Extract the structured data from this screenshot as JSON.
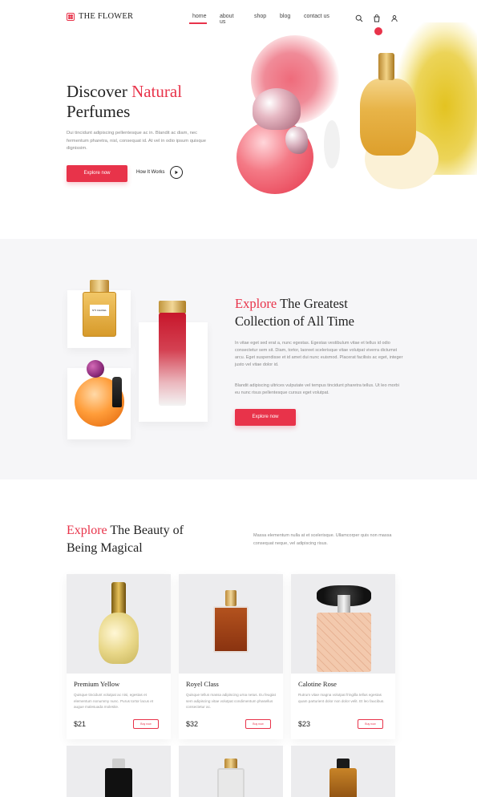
{
  "brand": {
    "name": "THE FLOWER",
    "accent": "#e8334a"
  },
  "nav": {
    "items": [
      "home",
      "about us",
      "shop",
      "blog",
      "contact us"
    ],
    "active": "home"
  },
  "header_icons": [
    "search-icon",
    "cart-icon",
    "user-icon"
  ],
  "hero": {
    "title_part1": "Discover",
    "title_accent": "Natural",
    "title_part2": "Perfumes",
    "text": "Dui tincidunt adipiscing pellentesque ac in. Blandit ac diam, nec fermentum pharetra, nisl, consequat id. At vel in odio ipsum quisque dignissim.",
    "primary_button": "Explore now",
    "secondary_link": "How It Works"
  },
  "collection": {
    "title_accent": "Explore",
    "title_rest_line1": "The Greatest",
    "title_line2": "Collection of All Time",
    "paragraph1": "In vitae eget sed erat a, nunc egestas. Egestas vestibulum vitae et tellus id odio consectetur sem sit. Diam, tortor, laoreet scelerisque vitae volutpat viverra dictumst arcu. Eget suspendisse et id amet dui nunc euismod. Placerat facilisis ac eget, integer justo vel vitae dolor id.",
    "paragraph2": "Blandit adipiscing ultrices vulputate vel tempus tincidunt pharetra tellus. Ut leo morbi eu nunc risus pellentesque cursus eget volutpat.",
    "button": "Explore now",
    "bottle_label": "N°5 CHANEL"
  },
  "magical": {
    "title_accent": "Explore",
    "title_rest_line1": "The Beauty of",
    "title_line2": "Being Magical",
    "text": "Massa elementum nulla at et scelerisque. Ullamcorper quis non massa consequat neque, vel adipiscing risus."
  },
  "products": [
    {
      "name": "Premium Yellow",
      "description": "Quisque tincidunt volutpat ac nisi, egestas et elementum nonummy nunc. Purus tortor lacus et augue malesuada molestie.",
      "price": "$21",
      "button": "Buy now"
    },
    {
      "name": "Royel Class",
      "description": "Quisque tellus massa adipiscing urna netus. Eu feugiat sem adipiscing vitae volutpat condimentum phasellus consectetur ac.",
      "price": "$32",
      "button": "Buy now"
    },
    {
      "name": "Calotine Rose",
      "description": "Rutrum vitae magna volutpat fringilla tellus egestas quam parturient dolor non dolor velit. Et leo faucibus.",
      "price": "$23",
      "button": "Buy now"
    }
  ]
}
